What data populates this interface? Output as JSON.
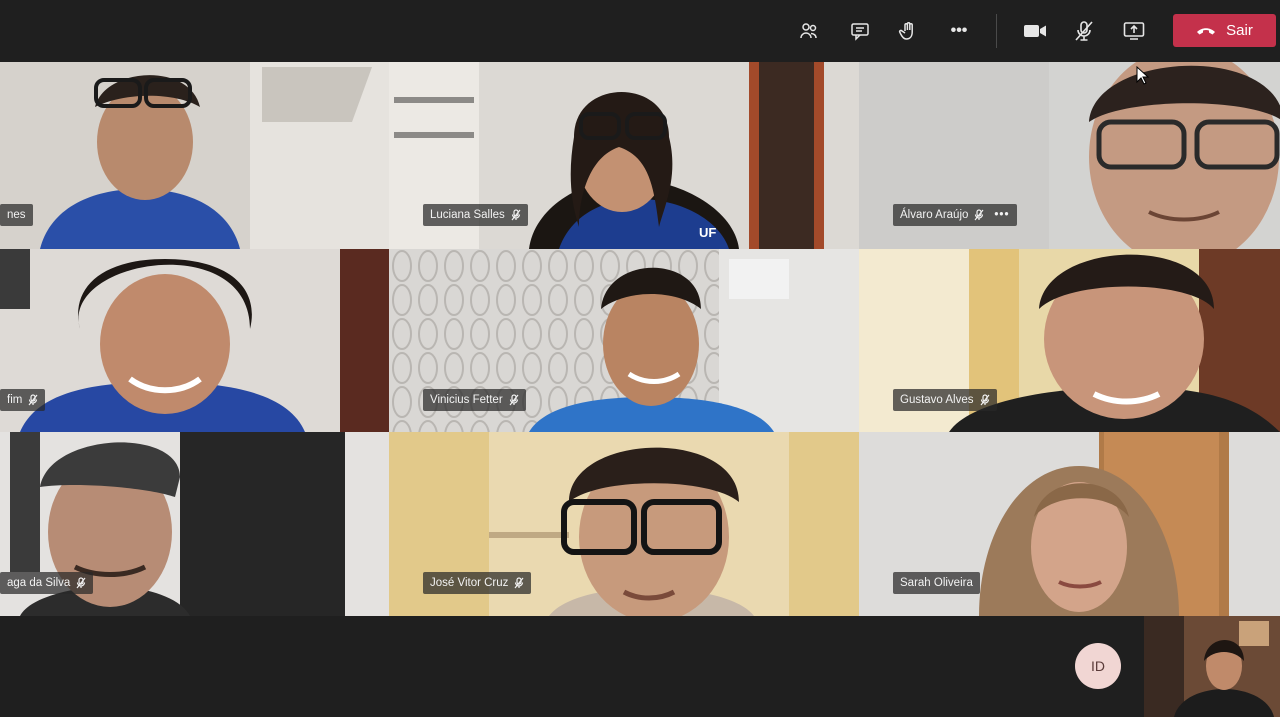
{
  "toolbar": {
    "icons": [
      "participants-icon",
      "chat-icon",
      "raise-hand-icon",
      "more-options-icon",
      "camera-icon",
      "mic-off-icon",
      "share-screen-icon"
    ],
    "more_label": "•••",
    "leave_label": "Sair",
    "leave_color": "#c4314b"
  },
  "participants": [
    {
      "name": "nes"
    },
    {
      "name": "Luciana Salles"
    },
    {
      "name": "Álvaro Araújo",
      "more": "•••"
    },
    {
      "name": "fim"
    },
    {
      "name": "Vinicius Fetter"
    },
    {
      "name": "Gustavo Alves"
    },
    {
      "name": "aga da Silva"
    },
    {
      "name": "José Vitor Cruz"
    },
    {
      "name": "Sarah Oliveira"
    }
  ],
  "shirt_text": "UF",
  "self_avatar_initials": "ID"
}
